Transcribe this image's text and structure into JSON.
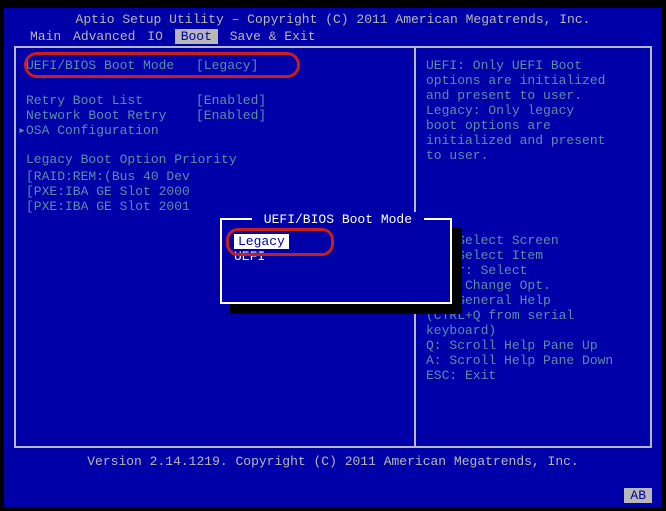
{
  "title": "Aptio Setup Utility – Copyright (C) 2011 American Megatrends, Inc.",
  "tabs": {
    "items": [
      "Main",
      "Advanced",
      "IO",
      "Boot",
      "Save & Exit"
    ],
    "activeIndex": 3
  },
  "left": {
    "bootMode": {
      "label": "UEFI/BIOS Boot Mode",
      "value": "[Legacy]"
    },
    "retryBootList": {
      "label": "Retry Boot List",
      "value": "[Enabled]"
    },
    "networkBootRetry": {
      "label": "Network Boot Retry",
      "value": "[Enabled]"
    },
    "osaConfig": {
      "label": "OSA Configuration"
    },
    "legacyPriorityHdr": "Legacy Boot Option Priority",
    "priority": [
      "[RAID:REM:(Bus 40 Dev",
      "[PXE:IBA GE Slot 2000",
      "[PXE:IBA GE Slot 2001"
    ]
  },
  "popup": {
    "title": " UEFI/BIOS Boot Mode ",
    "options": [
      "Legacy",
      "UEFI"
    ],
    "selectedIndex": 0
  },
  "right": {
    "desc": [
      "UEFI: Only UEFI Boot",
      "options are initialized",
      "and present to user.",
      "Legacy: Only legacy",
      "boot options are",
      "initialized and present",
      "to user."
    ],
    "help": [
      "    Select Screen",
      "    Select Item",
      "Enter: Select",
      "+/-: Change Opt.",
      "F1: General Help",
      "(CTRL+Q from serial",
      "keyboard)",
      "Q: Scroll Help Pane Up",
      "A: Scroll Help Pane Down",
      "ESC: Exit"
    ]
  },
  "footer": "Version 2.14.1219. Copyright (C) 2011 American Megatrends, Inc.",
  "corner": "AB"
}
